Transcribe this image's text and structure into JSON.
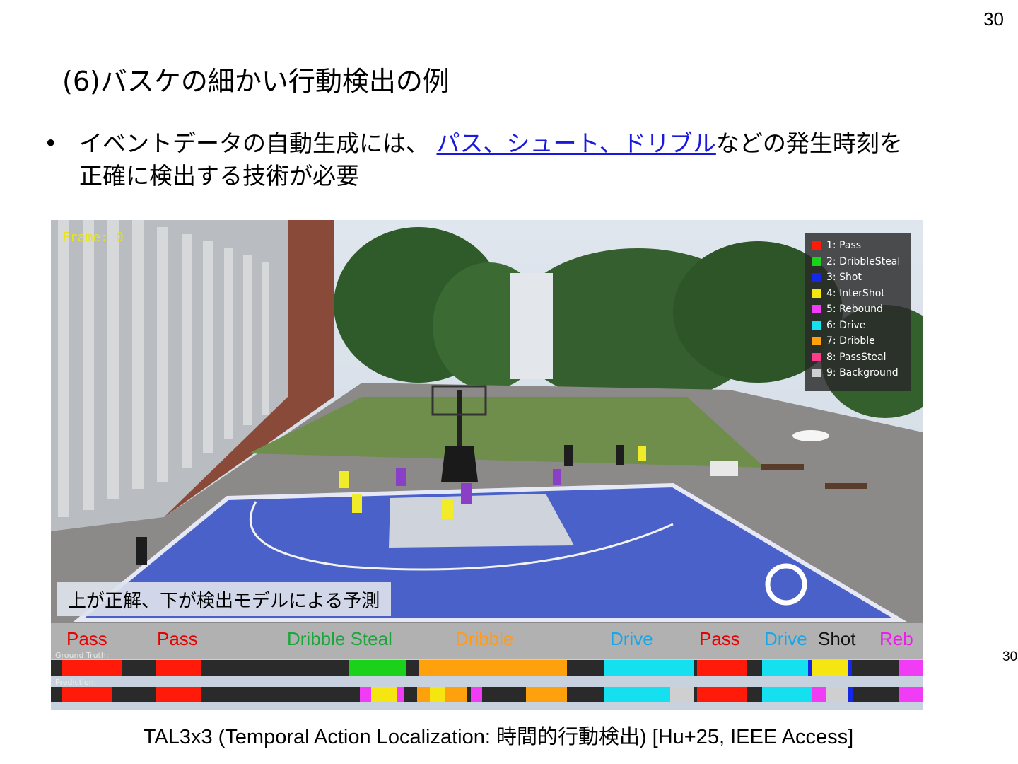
{
  "page_number": "30",
  "page_number_side": "30",
  "title": "(6)バスケの細かい行動検出の例",
  "bullet": {
    "symbol": "•",
    "text_before": "イベントデータの自動生成には、 ",
    "link_text": "パス、シュート、ドリブル",
    "text_after": "などの発生時刻を正確に検出する技術が必要"
  },
  "figure": {
    "frame_label": "Frame: 0",
    "legend": [
      {
        "label": "1:  Pass",
        "color": "#ff1a0a"
      },
      {
        "label": "2:  DribbleSteal",
        "color": "#19d219"
      },
      {
        "label": "3:  Shot",
        "color": "#1528e6"
      },
      {
        "label": "4:  InterShot",
        "color": "#f5e612"
      },
      {
        "label": "5:  Rebound",
        "color": "#f03cf5"
      },
      {
        "label": "6:  Drive",
        "color": "#15e0f0"
      },
      {
        "label": "7:  Dribble",
        "color": "#ffa10c"
      },
      {
        "label": "8:  PassSteal",
        "color": "#ff3c8c"
      },
      {
        "label": "9:  Background",
        "color": "#cfcfcf"
      }
    ],
    "caption": "上が正解、下が検出モデルによる予測",
    "event_labels": [
      {
        "text": "Pass",
        "color": "#e60000"
      },
      {
        "text": "Pass",
        "color": "#e60000"
      },
      {
        "text": "Dribble Steal",
        "color": "#1aa63a"
      },
      {
        "text": "Dribble",
        "color": "#ff9a1a"
      },
      {
        "text": "Drive",
        "color": "#19a6e6"
      },
      {
        "text": "Pass",
        "color": "#e60000"
      },
      {
        "text": "Drive",
        "color": "#19a6e6"
      },
      {
        "text": "Shot",
        "color": "#111111"
      },
      {
        "text": "Reb",
        "color": "#ee1aee"
      }
    ],
    "gt_title": "Ground Truth:",
    "pred_title": "Prediction:"
  },
  "citation": "TAL3x3 (Temporal Action Localization: 時間的行動検出) [Hu+25, IEEE Access]"
}
